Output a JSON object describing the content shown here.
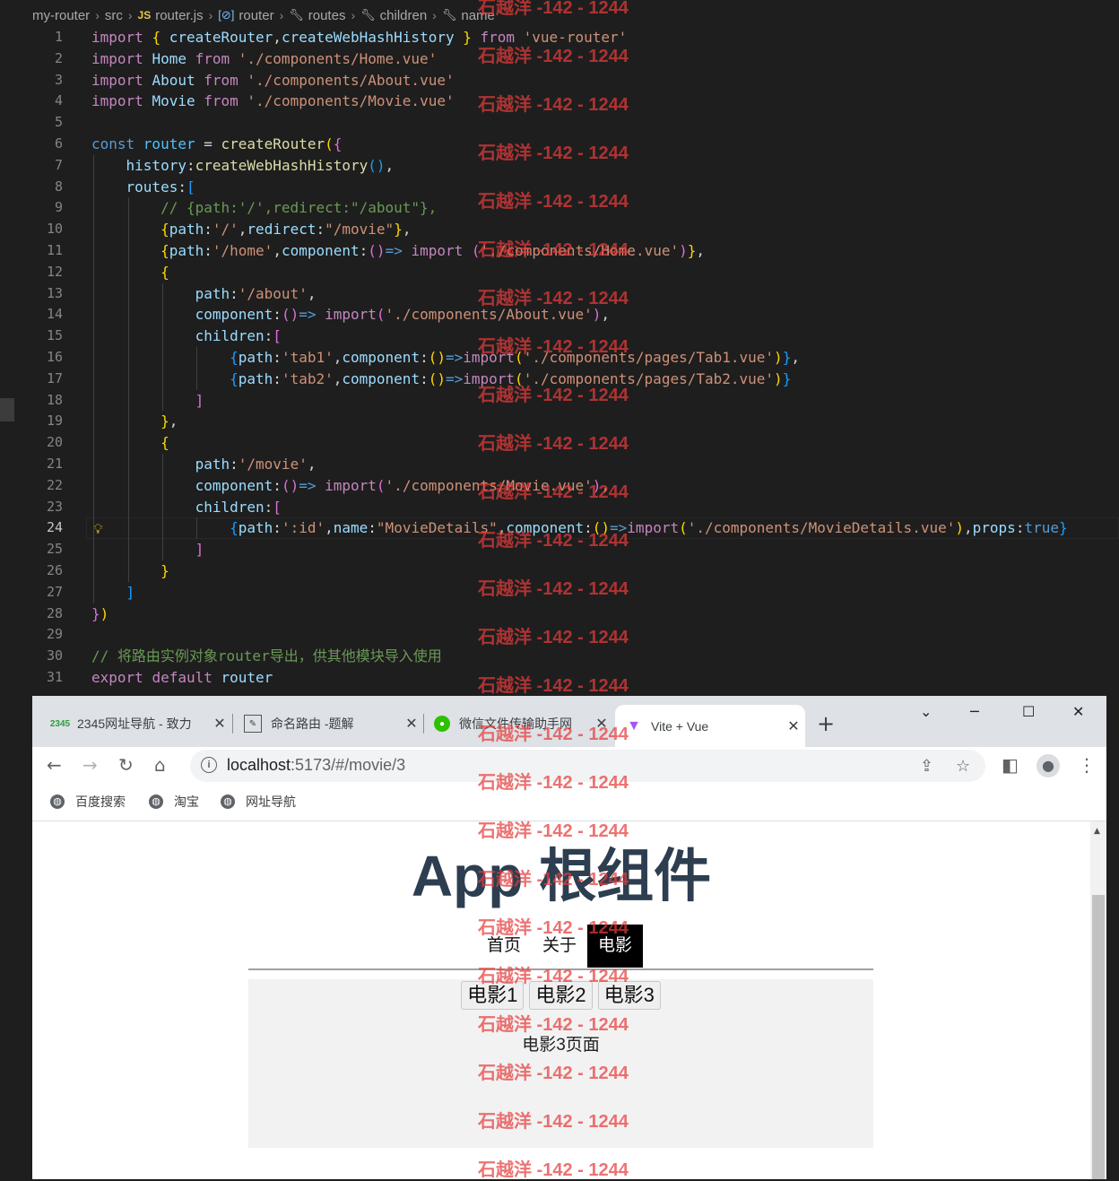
{
  "breadcrumb": {
    "items": [
      {
        "label": "my-router",
        "icon": ""
      },
      {
        "label": "src",
        "icon": ""
      },
      {
        "label": "router.js",
        "icon": "JS"
      },
      {
        "label": "router",
        "icon": "variable-icon"
      },
      {
        "label": "routes",
        "icon": "wrench-icon"
      },
      {
        "label": "children",
        "icon": "wrench-icon"
      },
      {
        "label": "name",
        "icon": "wrench-icon"
      }
    ]
  },
  "editor": {
    "active_line": "24",
    "lines": [
      {
        "n": "1",
        "t": [
          [
            "kw",
            "import "
          ],
          [
            "b1",
            "{ "
          ],
          [
            "vr",
            "createRouter"
          ],
          [
            "",
            ","
          ],
          [
            "vr",
            "createWebHashHistory"
          ],
          [
            "b1",
            " }"
          ],
          [
            "kw",
            " from "
          ],
          [
            "st",
            "'vue-router'"
          ]
        ]
      },
      {
        "n": "2",
        "t": [
          [
            "kw",
            "import "
          ],
          [
            "vr",
            "Home"
          ],
          [
            "kw",
            " from "
          ],
          [
            "st",
            "'./components/Home.vue'"
          ]
        ]
      },
      {
        "n": "3",
        "t": [
          [
            "kw",
            "import "
          ],
          [
            "vr",
            "About"
          ],
          [
            "kw",
            " from "
          ],
          [
            "st",
            "'./components/About.vue'"
          ]
        ]
      },
      {
        "n": "4",
        "t": [
          [
            "kw",
            "import "
          ],
          [
            "vr",
            "Movie"
          ],
          [
            "kw",
            " from "
          ],
          [
            "st",
            "'./components/Movie.vue'"
          ]
        ]
      },
      {
        "n": "5",
        "t": []
      },
      {
        "n": "6",
        "t": [
          [
            "dk",
            "const "
          ],
          [
            "cn",
            "router"
          ],
          [
            "",
            " = "
          ],
          [
            "fn",
            "createRouter"
          ],
          [
            "b1",
            "("
          ],
          [
            "b2",
            "{"
          ]
        ]
      },
      {
        "n": "7",
        "t": [
          [
            "",
            "    "
          ],
          [
            "vr",
            "history"
          ],
          [
            "",
            ":"
          ],
          [
            "fn",
            "createWebHashHistory"
          ],
          [
            "b3",
            "()"
          ],
          [
            "",
            ","
          ]
        ]
      },
      {
        "n": "8",
        "t": [
          [
            "",
            "    "
          ],
          [
            "vr",
            "routes"
          ],
          [
            "",
            ":"
          ],
          [
            "b3",
            "["
          ]
        ]
      },
      {
        "n": "9",
        "t": [
          [
            "",
            "        "
          ],
          [
            "cm",
            "// {path:'/',redirect:\"/about\"},"
          ]
        ]
      },
      {
        "n": "10",
        "t": [
          [
            "",
            "        "
          ],
          [
            "b1",
            "{"
          ],
          [
            "vr",
            "path"
          ],
          [
            "",
            ":"
          ],
          [
            "st",
            "'/'"
          ],
          [
            "",
            ","
          ],
          [
            "vr",
            "redirect"
          ],
          [
            "",
            ":"
          ],
          [
            "st",
            "\"/movie\""
          ],
          [
            "b1",
            "}"
          ],
          [
            "",
            ","
          ]
        ]
      },
      {
        "n": "11",
        "t": [
          [
            "",
            "        "
          ],
          [
            "b1",
            "{"
          ],
          [
            "vr",
            "path"
          ],
          [
            "",
            ":"
          ],
          [
            "st",
            "'/home'"
          ],
          [
            "",
            ","
          ],
          [
            "vr",
            "component"
          ],
          [
            "",
            ":"
          ],
          [
            "b2",
            "()"
          ],
          [
            "dk",
            "=> "
          ],
          [
            "kw",
            "import "
          ],
          [
            "b2",
            "("
          ],
          [
            "st",
            "'./components/Home.vue'"
          ],
          [
            "b2",
            ")"
          ],
          [
            "b1",
            "}"
          ],
          [
            "",
            ","
          ]
        ]
      },
      {
        "n": "12",
        "t": [
          [
            "",
            "        "
          ],
          [
            "b1",
            "{"
          ]
        ]
      },
      {
        "n": "13",
        "t": [
          [
            "",
            "            "
          ],
          [
            "vr",
            "path"
          ],
          [
            "",
            ":"
          ],
          [
            "st",
            "'/about'"
          ],
          [
            "",
            ","
          ]
        ]
      },
      {
        "n": "14",
        "t": [
          [
            "",
            "            "
          ],
          [
            "vr",
            "component"
          ],
          [
            "",
            ":"
          ],
          [
            "b2",
            "()"
          ],
          [
            "dk",
            "=> "
          ],
          [
            "kw",
            "import"
          ],
          [
            "b2",
            "("
          ],
          [
            "st",
            "'./components/About.vue'"
          ],
          [
            "b2",
            ")"
          ],
          [
            "",
            ","
          ]
        ]
      },
      {
        "n": "15",
        "t": [
          [
            "",
            "            "
          ],
          [
            "vr",
            "children"
          ],
          [
            "",
            ":"
          ],
          [
            "b2",
            "["
          ]
        ]
      },
      {
        "n": "16",
        "t": [
          [
            "",
            "                "
          ],
          [
            "b3",
            "{"
          ],
          [
            "vr",
            "path"
          ],
          [
            "",
            ":"
          ],
          [
            "st",
            "'tab1'"
          ],
          [
            "",
            ","
          ],
          [
            "vr",
            "component"
          ],
          [
            "",
            ":"
          ],
          [
            "b1",
            "()"
          ],
          [
            "dk",
            "=>"
          ],
          [
            "kw",
            "import"
          ],
          [
            "b1",
            "("
          ],
          [
            "st",
            "'./components/pages/Tab1.vue'"
          ],
          [
            "b1",
            ")"
          ],
          [
            "b3",
            "}"
          ],
          [
            "",
            ","
          ]
        ]
      },
      {
        "n": "17",
        "t": [
          [
            "",
            "                "
          ],
          [
            "b3",
            "{"
          ],
          [
            "vr",
            "path"
          ],
          [
            "",
            ":"
          ],
          [
            "st",
            "'tab2'"
          ],
          [
            "",
            ","
          ],
          [
            "vr",
            "component"
          ],
          [
            "",
            ":"
          ],
          [
            "b1",
            "()"
          ],
          [
            "dk",
            "=>"
          ],
          [
            "kw",
            "import"
          ],
          [
            "b1",
            "("
          ],
          [
            "st",
            "'./components/pages/Tab2.vue'"
          ],
          [
            "b1",
            ")"
          ],
          [
            "b3",
            "}"
          ]
        ]
      },
      {
        "n": "18",
        "t": [
          [
            "",
            "            "
          ],
          [
            "b2",
            "]"
          ]
        ]
      },
      {
        "n": "19",
        "t": [
          [
            "",
            "        "
          ],
          [
            "b1",
            "}"
          ],
          [
            "",
            ","
          ]
        ]
      },
      {
        "n": "20",
        "t": [
          [
            "",
            "        "
          ],
          [
            "b1",
            "{"
          ]
        ]
      },
      {
        "n": "21",
        "t": [
          [
            "",
            "            "
          ],
          [
            "vr",
            "path"
          ],
          [
            "",
            ":"
          ],
          [
            "st",
            "'/movie'"
          ],
          [
            "",
            ","
          ]
        ]
      },
      {
        "n": "22",
        "t": [
          [
            "",
            "            "
          ],
          [
            "vr",
            "component"
          ],
          [
            "",
            ":"
          ],
          [
            "b2",
            "()"
          ],
          [
            "dk",
            "=> "
          ],
          [
            "kw",
            "import"
          ],
          [
            "b2",
            "("
          ],
          [
            "st",
            "'./components/Movie.vue'"
          ],
          [
            "b2",
            ")"
          ],
          [
            "",
            ","
          ]
        ]
      },
      {
        "n": "23",
        "t": [
          [
            "",
            "            "
          ],
          [
            "vr",
            "children"
          ],
          [
            "",
            ":"
          ],
          [
            "b2",
            "["
          ]
        ]
      },
      {
        "n": "24",
        "t": [
          [
            "",
            "                "
          ],
          [
            "b3",
            "{"
          ],
          [
            "vr",
            "path"
          ],
          [
            "",
            ":"
          ],
          [
            "st",
            "':id'"
          ],
          [
            "",
            ","
          ],
          [
            "vr",
            "name"
          ],
          [
            "",
            ":"
          ],
          [
            "st",
            "\"MovieDetails\""
          ],
          [
            "",
            ","
          ],
          [
            "vr",
            "component"
          ],
          [
            "",
            ":"
          ],
          [
            "b1",
            "()"
          ],
          [
            "dk",
            "=>"
          ],
          [
            "kw",
            "import"
          ],
          [
            "b1",
            "("
          ],
          [
            "st",
            "'./components/MovieDetails.vue'"
          ],
          [
            "b1",
            ")"
          ],
          [
            "",
            ","
          ],
          [
            "vr",
            "props"
          ],
          [
            "",
            ":"
          ],
          [
            "dk",
            "true"
          ],
          [
            "b3",
            "}"
          ]
        ]
      },
      {
        "n": "25",
        "t": [
          [
            "",
            "            "
          ],
          [
            "b2",
            "]"
          ]
        ]
      },
      {
        "n": "26",
        "t": [
          [
            "",
            "        "
          ],
          [
            "b1",
            "}"
          ]
        ]
      },
      {
        "n": "27",
        "t": [
          [
            "",
            "    "
          ],
          [
            "b3",
            "]"
          ]
        ]
      },
      {
        "n": "28",
        "t": [
          [
            "b2",
            "}"
          ],
          [
            "b1",
            ")"
          ]
        ]
      },
      {
        "n": "29",
        "t": []
      },
      {
        "n": "30",
        "t": [
          [
            "cm",
            "// 将路由实例对象router导出，供其他模块导入使用"
          ]
        ]
      },
      {
        "n": "31",
        "t": [
          [
            "kw",
            "export "
          ],
          [
            "kw",
            "default "
          ],
          [
            "vr",
            "router"
          ]
        ]
      }
    ]
  },
  "browser": {
    "tabs": [
      {
        "title": "2345网址导航 - 致力",
        "icon": "2345-icon",
        "active": false
      },
      {
        "title": "命名路由 -题解",
        "icon": "page-icon",
        "active": false
      },
      {
        "title": "微信文件传输助手网",
        "icon": "wechat-icon",
        "active": false
      },
      {
        "title": "Vite + Vue",
        "icon": "vite-icon",
        "active": true
      }
    ],
    "url_host": "localhost",
    "url_rest": ":5173/#/movie/3",
    "bookmarks": [
      "百度搜索",
      "淘宝",
      "网址导航"
    ]
  },
  "app": {
    "title": "App 根组件",
    "nav": [
      "首页",
      "关于",
      "电影"
    ],
    "active_nav": "电影",
    "movie_buttons": [
      "电影1",
      "电影2",
      "电影3"
    ],
    "page_text": "电影3页面"
  },
  "watermark": "石越洋 -142 - 1244"
}
